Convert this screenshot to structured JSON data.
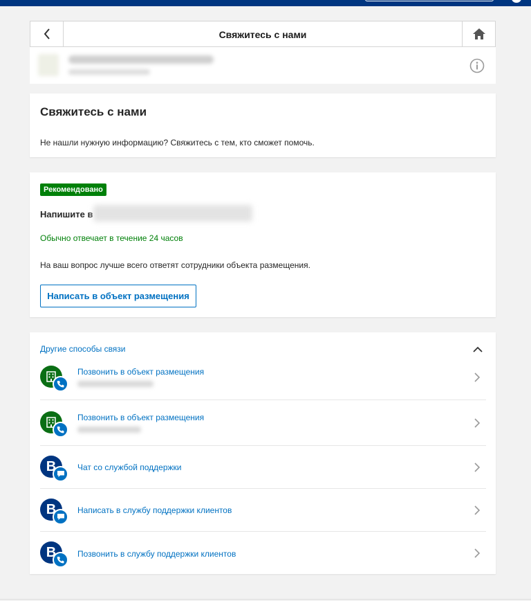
{
  "header": {
    "title": "Свяжитесь с нами",
    "back_icon": "chevron-left-icon",
    "home_icon": "home-icon"
  },
  "property": {
    "info_icon": "info-icon"
  },
  "contact_card": {
    "title": "Свяжитесь с нами",
    "text": "Не нашли нужную информацию? Свяжитесь с тем, кто сможет помочь."
  },
  "recommended": {
    "badge": "Рекомендовано",
    "title": "Напишите в",
    "reply_time": "Обычно отвечает в течение 24 часов",
    "description": "На ваш вопрос лучше всего ответят сотрудники объекта размещения.",
    "button": "Написать в объект размещения"
  },
  "other": {
    "heading": "Другие способы связи",
    "items": [
      {
        "label": "Позвонить в объект размещения",
        "icon": "building-icon",
        "badge_icon": "phone-icon"
      },
      {
        "label": "Позвонить в объект размещения",
        "icon": "building-icon",
        "badge_icon": "phone-icon"
      },
      {
        "label": "Чат со службой поддержки",
        "icon_text": "B",
        "badge_icon": "chat-icon"
      },
      {
        "label": "Написать в службу поддержки клиентов",
        "icon_text": "B",
        "badge_icon": "chat-icon"
      },
      {
        "label": "Позвонить в службу поддержки клиентов",
        "icon_text": "B",
        "badge_icon": "phone-icon"
      }
    ]
  },
  "colors": {
    "brand": "#003580",
    "link": "#0071c2",
    "success": "#008009"
  }
}
